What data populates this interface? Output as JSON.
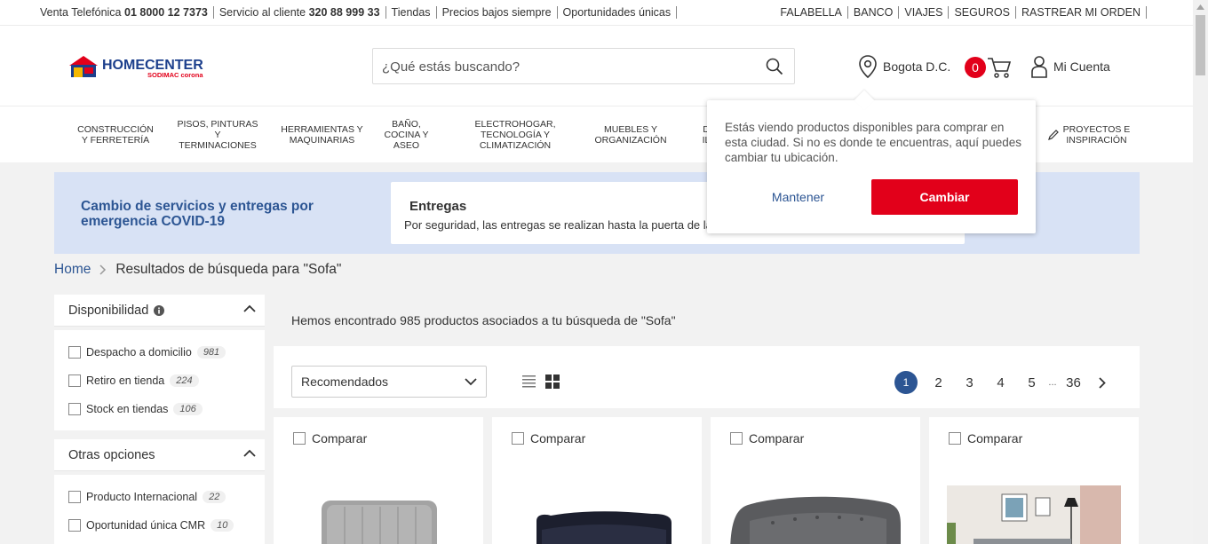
{
  "topbar": {
    "phone_label": "Venta Telefónica",
    "phone_number": "01 8000 12 7373",
    "service_label": "Servicio al cliente",
    "service_number": "320 88 999 33",
    "stores": "Tiendas",
    "low_prices": "Precios bajos siempre",
    "unique": "Oportunidades únicas",
    "right_links": [
      "FALABELLA",
      "BANCO",
      "VIAJES",
      "SEGUROS",
      "RASTREAR MI ORDEN"
    ]
  },
  "header": {
    "logo_brand": "HOMECENTER",
    "logo_sub": "SODIMAC corona",
    "search_placeholder": "¿Qué estás buscando?",
    "location": "Bogota D.C.",
    "cart_count": "0",
    "account": "Mi Cuenta"
  },
  "nav": {
    "categories": [
      {
        "line1": "Construcción",
        "line2": "y ferretería",
        "line3": ""
      },
      {
        "line1": "Pisos, pinturas y",
        "line2": "terminaciones",
        "line3": ""
      },
      {
        "line1": "Herramientas y",
        "line2": "maquinarias",
        "line3": ""
      },
      {
        "line1": "Baño,",
        "line2": "cocina y",
        "line3": "aseo"
      },
      {
        "line1": "Electrohogar,",
        "line2": "tecnología y",
        "line3": "climatización"
      },
      {
        "line1": "Muebles y",
        "line2": "organización",
        "line3": ""
      },
      {
        "line1": "D",
        "line2": "IL",
        "line3": ""
      },
      {
        "line1": "Proyectos e",
        "line2": "inspiración",
        "line3": ""
      }
    ]
  },
  "covid": {
    "title": "Cambio de servicios y entregas por emergencia COVID-19",
    "card_title": "Entregas",
    "card_text": "Por seguridad, las entregas se realizan hasta la puerta de la ca"
  },
  "popup": {
    "text": "Estás viendo productos disponibles para comprar en esta ciudad. Si no es donde te encuentras, aquí puedes cambiar tu ubicación.",
    "keep": "Mantener",
    "change": "Cambiar"
  },
  "breadcrumb": {
    "home": "Home",
    "current": "Resultados de búsqueda para \"Sofa\""
  },
  "filters": {
    "availability": {
      "title": "Disponibilidad",
      "options": [
        {
          "label": "Despacho a domicilio",
          "count": "981"
        },
        {
          "label": "Retiro en tienda",
          "count": "224"
        },
        {
          "label": "Stock en tiendas",
          "count": "106"
        }
      ]
    },
    "other": {
      "title": "Otras opciones",
      "options": [
        {
          "label": "Producto Internacional",
          "count": "22"
        },
        {
          "label": "Oportunidad única CMR",
          "count": "10"
        }
      ]
    }
  },
  "results": {
    "summary": "Hemos encontrado 985 productos asociados a tu búsqueda de \"Sofa\"",
    "sort": "Recomendados",
    "pages": [
      "2",
      "3",
      "4",
      "5"
    ],
    "current_page": "1",
    "ellipsis": "...",
    "last_page": "36"
  },
  "products": [
    {
      "compare": "Comparar"
    },
    {
      "compare": "Comparar"
    },
    {
      "compare": "Comparar"
    },
    {
      "compare": "Comparar"
    }
  ],
  "colors": {
    "brand_red": "#e2001a",
    "brand_blue": "#2c5593",
    "covid_bg": "#d8e2f5"
  }
}
